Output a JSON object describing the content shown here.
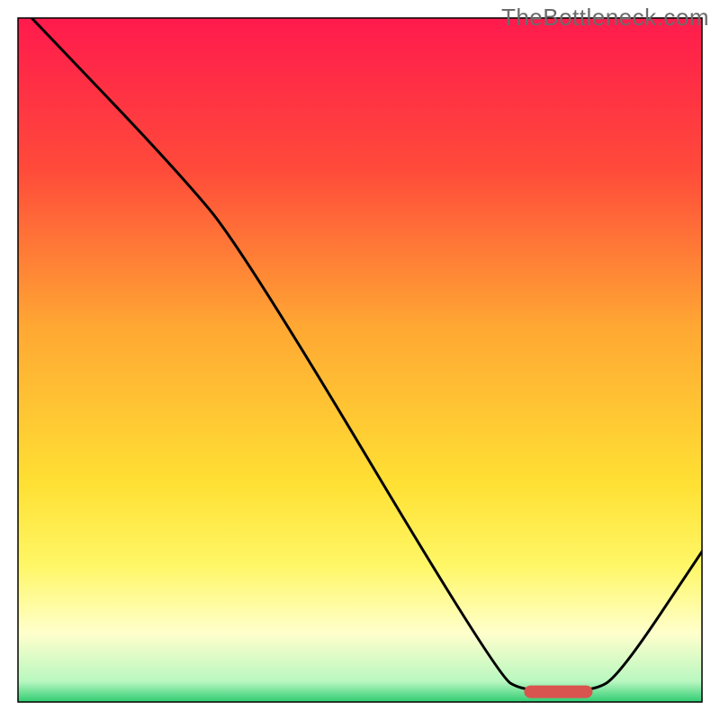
{
  "watermark": "TheBottleneck.com",
  "chart_data": {
    "type": "line",
    "title": "",
    "xlabel": "",
    "ylabel": "",
    "xlim": [
      0,
      100
    ],
    "ylim": [
      0,
      100
    ],
    "gradient_stops": [
      {
        "offset": 0,
        "color": "#ff1a4d"
      },
      {
        "offset": 22,
        "color": "#ff4a3a"
      },
      {
        "offset": 45,
        "color": "#ffa733"
      },
      {
        "offset": 68,
        "color": "#ffe033"
      },
      {
        "offset": 80,
        "color": "#fff766"
      },
      {
        "offset": 90,
        "color": "#ffffcc"
      },
      {
        "offset": 97,
        "color": "#b9f7c0"
      },
      {
        "offset": 100,
        "color": "#2ecc71"
      }
    ],
    "series": [
      {
        "name": "bottleneck-curve",
        "color": "#000000",
        "points": [
          {
            "x": 2,
            "y": 100
          },
          {
            "x": 23,
            "y": 78
          },
          {
            "x": 33,
            "y": 66
          },
          {
            "x": 70,
            "y": 4
          },
          {
            "x": 74,
            "y": 1.5
          },
          {
            "x": 84,
            "y": 1.5
          },
          {
            "x": 88,
            "y": 4
          },
          {
            "x": 100,
            "y": 22
          }
        ]
      }
    ],
    "marker": {
      "x_start": 74,
      "x_end": 84,
      "y": 1.5,
      "color": "#d9534f"
    },
    "border": {
      "inset": 20,
      "color": "#000000",
      "width": 1.5
    }
  }
}
